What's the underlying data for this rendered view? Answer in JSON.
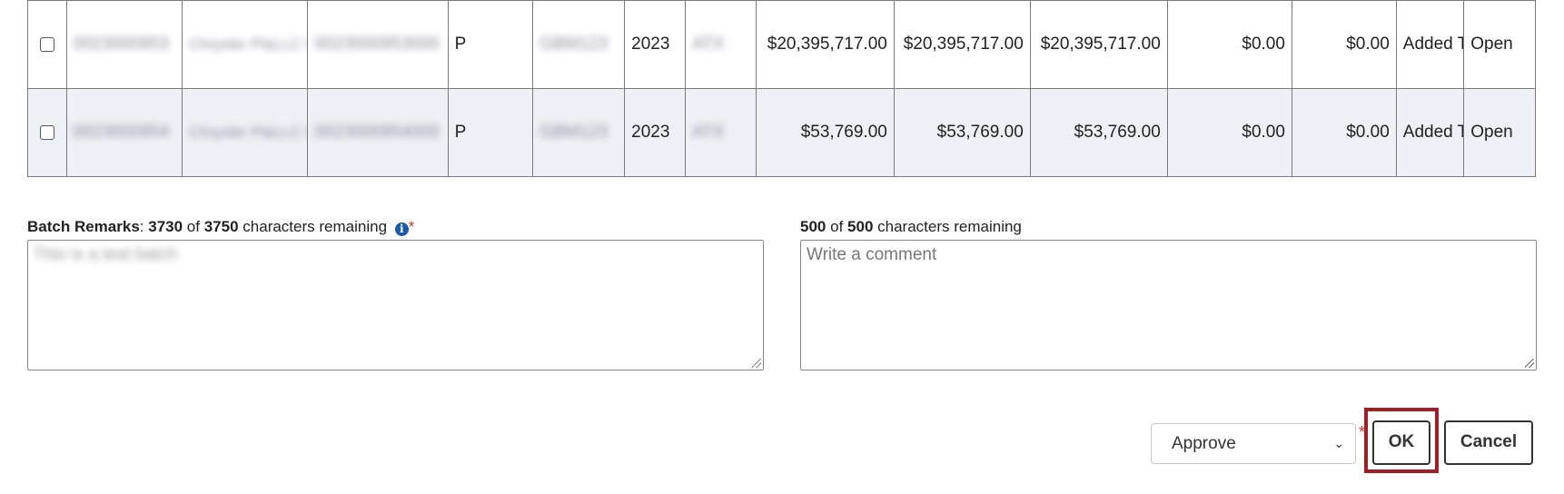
{
  "table": {
    "rows": [
      {
        "id_redacted": "0023000953",
        "name_line1_redacted": "Chrysler Pla",
        "name_line2_redacted": "LLC Clients, Inc.",
        "ref_redacted": "0023000953000",
        "type": "P",
        "code_redacted": "GBM123",
        "year": "2023",
        "misc_redacted": "ATX",
        "amount1": "$20,395,717.00",
        "amount2": "$20,395,717.00",
        "amount3": "$20,395,717.00",
        "amount4": "$0.00",
        "amount5": "$0.00",
        "status": "Added To Batch",
        "state": "Open"
      },
      {
        "id_redacted": "0023000954",
        "name_line1_redacted": "Chrysler Pla",
        "name_line2_redacted": "LLC Clients, Inc.",
        "ref_redacted": "0023000954000",
        "type": "P",
        "code_redacted": "GBM123",
        "year": "2023",
        "misc_redacted": "ATX",
        "amount1": "$53,769.00",
        "amount2": "$53,769.00",
        "amount3": "$53,769.00",
        "amount4": "$0.00",
        "amount5": "$0.00",
        "status": "Added To Batch",
        "state": "Open"
      }
    ]
  },
  "batch_remarks": {
    "label": "Batch Remarks",
    "remaining": "3730",
    "of": "of",
    "max": "3750",
    "suffix": "characters remaining",
    "value_redacted": "This is a test batch"
  },
  "comment": {
    "remaining": "500",
    "of": "of",
    "max": "500",
    "suffix": "characters remaining",
    "placeholder": "Write a comment"
  },
  "action_select": {
    "selected": "Approve"
  },
  "buttons": {
    "ok": "OK",
    "cancel": "Cancel"
  },
  "icons": {
    "info": "info-icon",
    "chevron": "chevron-down-icon"
  },
  "colors": {
    "highlight": "#a31d26",
    "info": "#1a5aa6",
    "required": "#c0392b",
    "alt_row": "#eff0f5"
  }
}
